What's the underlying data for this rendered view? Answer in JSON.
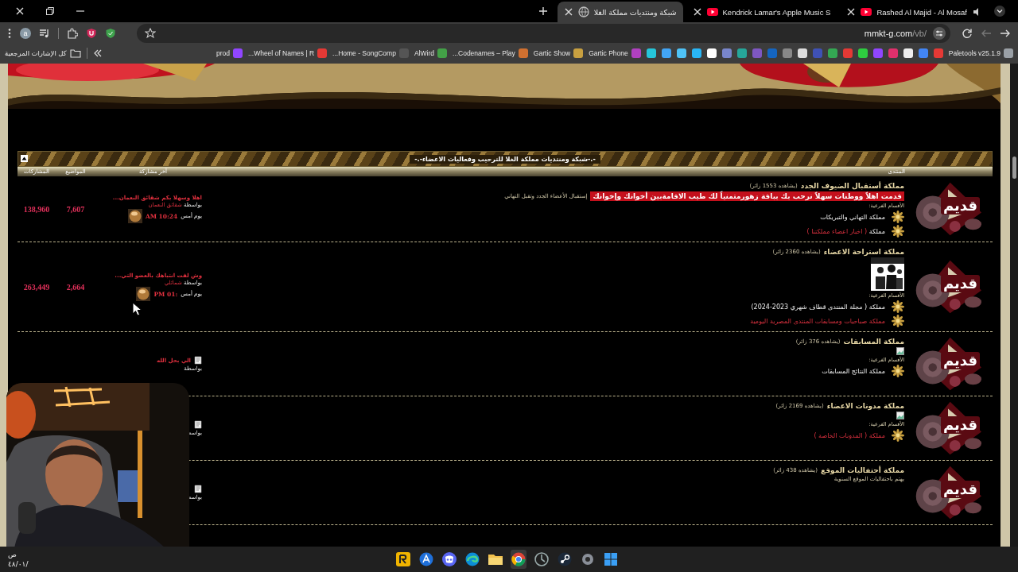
{
  "browser": {
    "tabs": [
      {
        "title": "Rashed Al Majid - Al Mosaf",
        "kind": "youtube",
        "audio": true,
        "selected": false
      },
      {
        "title": "Kendrick Lamar's Apple Music S",
        "kind": "youtube",
        "audio": false,
        "selected": false
      },
      {
        "title": "شبكة ومنتديات مملكة الغلا",
        "kind": "site",
        "audio": false,
        "selected": true
      }
    ],
    "address": {
      "host": "mmkt-g.com",
      "path": "/vb/"
    },
    "profile_initial": "a",
    "bookmarks": [
      {
        "kind": "labeled",
        "label": "Paletools v25.1.9",
        "color": "#9aa0a6"
      },
      {
        "kind": "icon",
        "color": "#e53935"
      },
      {
        "kind": "icon",
        "color": "#4285f4"
      },
      {
        "kind": "icon",
        "color": "#eeeeee"
      },
      {
        "kind": "icon",
        "color": "#e1306c"
      },
      {
        "kind": "icon",
        "color": "#9146ff"
      },
      {
        "kind": "icon",
        "color": "#2ecc40"
      },
      {
        "kind": "icon",
        "color": "#e53935"
      },
      {
        "kind": "icon",
        "color": "#34a853"
      },
      {
        "kind": "icon",
        "color": "#3f51b5"
      },
      {
        "kind": "icon",
        "color": "#dddddd"
      },
      {
        "kind": "icon",
        "color": "#888888"
      },
      {
        "kind": "icon",
        "color": "#1565c0"
      },
      {
        "kind": "icon",
        "color": "#7e57c2"
      },
      {
        "kind": "icon",
        "color": "#26a69a"
      },
      {
        "kind": "icon",
        "color": "#7986cb"
      },
      {
        "kind": "icon",
        "color": "#ffffff"
      },
      {
        "kind": "icon",
        "color": "#29b6f6"
      },
      {
        "kind": "icon",
        "color": "#4fc3f7"
      },
      {
        "kind": "icon",
        "color": "#42a5f5"
      },
      {
        "kind": "icon",
        "color": "#26c6da"
      },
      {
        "kind": "labeled",
        "label": "Gartic Phone",
        "color": "#b040c0"
      },
      {
        "kind": "labeled",
        "label": "Gartic Show",
        "color": "#c8a040"
      },
      {
        "kind": "labeled",
        "label": "Codenames – Play...",
        "color": "#d07030"
      },
      {
        "kind": "labeled",
        "label": "AlWird",
        "color": "#43a047"
      },
      {
        "kind": "labeled",
        "label": "Home - SongComp...",
        "color": "#555555"
      },
      {
        "kind": "labeled",
        "label": "Wheel of Names | R...",
        "color": "#e53935"
      },
      {
        "kind": "labeled",
        "label": "prod",
        "color": "#9146ff"
      }
    ],
    "all_bookmarks": "كل الإشارات المرجعية"
  },
  "forum": {
    "heading": "-.-شبكة ومنتديات مملكة الغلا للترحيب وفعاليات الاعضاء-.-",
    "columns": {
      "forum": "المنتدى",
      "last_post": "آخر مشاركة",
      "threads": "المواضيع",
      "posts": "المشاركات"
    },
    "rows": [
      {
        "status_label": "قديم",
        "title": "مملكة أستقبال الضيوف الجدد",
        "viewers": "(يشاهده 1553 زائر)",
        "banner": "قدمت اهلاً ووطنات سهلاً نرحب بك بباقة زهورمتمنياً لك طيب الاقامةبين أخوانك وإخوانك",
        "description": "إستقبال الأعضاء الجدد وتقبل التهاني",
        "subforums_label": "الأقسام الفرعية:",
        "subforums": [
          {
            "kind": "plain",
            "text": "مملكة التهاني والتبريكات"
          },
          {
            "kind": "mixed",
            "prefix": "مملكة",
            "text": "( اخبار اعضاء مملكتنا )"
          }
        ],
        "last_post": {
          "kind": "avatar",
          "title": "اهلا وسهلا بكم شقائق النعمان...",
          "by": "بواسطة",
          "author": "شقائق النعمان",
          "day": "يوم أمس",
          "time": "AM 10:24"
        },
        "threads": "7,607",
        "posts": "138,960"
      },
      {
        "status_label": "قديم",
        "title": "مملكة استراحة الاعضاء",
        "viewers": "(يشاهده 2360 زائر)",
        "forum_image": {
          "kind": "picture"
        },
        "subforums_label": "الأقسام الفرعية:",
        "subforums": [
          {
            "kind": "plain",
            "text": "مملكة ( مجلة المنتدى قطاف شهري 2023-2024)"
          },
          {
            "kind": "red",
            "text": "مملكة صباحيات ومسابقات المنتدى المصرية اليومية"
          }
        ],
        "last_post": {
          "kind": "avatar",
          "title": "وش لفت انتباهك بالعضو التي...",
          "by": "بواسطة",
          "author": "شمائلي",
          "day": "يوم أمس",
          "time": "PM 01:"
        },
        "threads": "2,664",
        "posts": "263,449"
      },
      {
        "status_label": "قديم",
        "title": "مملكة المسابقات",
        "viewers": "(يشاهده 376 زائر)",
        "forum_image": {
          "kind": "broken"
        },
        "subforums_label": "الأقسام الفرعية:",
        "subforums": [
          {
            "kind": "plain",
            "text": "مملكة النتائج المسابقات"
          }
        ],
        "last_post": {
          "kind": "document",
          "title": "الي بحل الله",
          "by": "بواسطة"
        }
      },
      {
        "status_label": "قديم",
        "title": "مملكة مدونات الاعضاء",
        "viewers": "(يشاهده 2169 زائر)",
        "forum_image": {
          "kind": "broken"
        },
        "subforums_label": "الأقسام الفرعية:",
        "subforums": [
          {
            "kind": "red",
            "text": "مملكة ( المدونات الخاصة )"
          }
        ],
        "last_post": {
          "kind": "document",
          "by": "بواسه"
        }
      },
      {
        "status_label": "قديم",
        "title": "مملكة أحتفاليات الموقع",
        "viewers": "(يشاهده 438 زائر)",
        "description": "يهتم باحتفاليات الموقع السنوية",
        "last_post": {
          "kind": "document",
          "by": "بواسه"
        }
      }
    ]
  },
  "taskbar": {
    "clock_time": "ص",
    "clock_date": "٤٨/٠١/"
  }
}
